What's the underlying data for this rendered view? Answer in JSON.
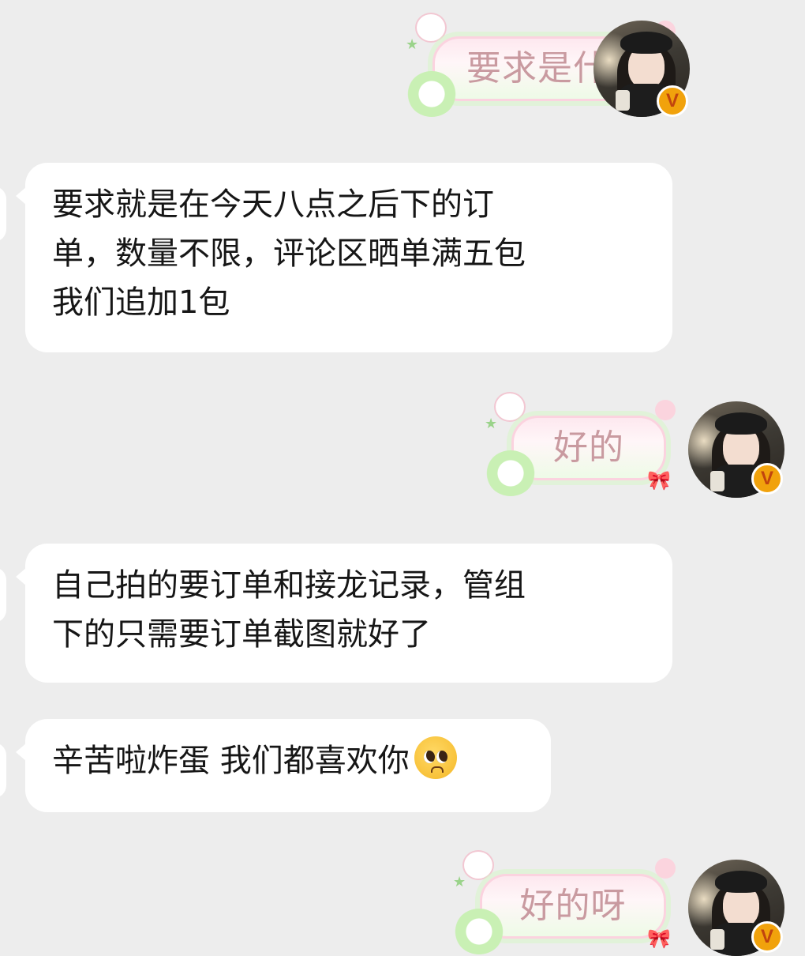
{
  "conversation": {
    "messages": [
      {
        "side": "right",
        "type": "sticker",
        "text": "要求是什么?"
      },
      {
        "side": "left",
        "type": "text",
        "lines": [
          "要求就是在今天八点之后下的订",
          "单，数量不限，评论区晒单满五包",
          "我们追加1包"
        ]
      },
      {
        "side": "right",
        "type": "sticker",
        "text": "好的"
      },
      {
        "side": "left",
        "type": "text",
        "lines": [
          "自己拍的要订单和接龙记录，管组",
          "下的只需要订单截图就好了"
        ]
      },
      {
        "side": "left",
        "type": "text",
        "lines": [
          "辛苦啦炸蛋 我们都喜欢你"
        ],
        "emoji": "pleading-face-emoji"
      },
      {
        "side": "right",
        "type": "sticker",
        "text": "好的呀"
      }
    ]
  },
  "self_avatar": {
    "badge": "V",
    "badge_color": "#f1a20c"
  },
  "colors": {
    "background": "#ededed",
    "bubble_left": "#ffffff",
    "sticker_text": "#c99aa0",
    "sticker_border": "#fbd3df"
  }
}
